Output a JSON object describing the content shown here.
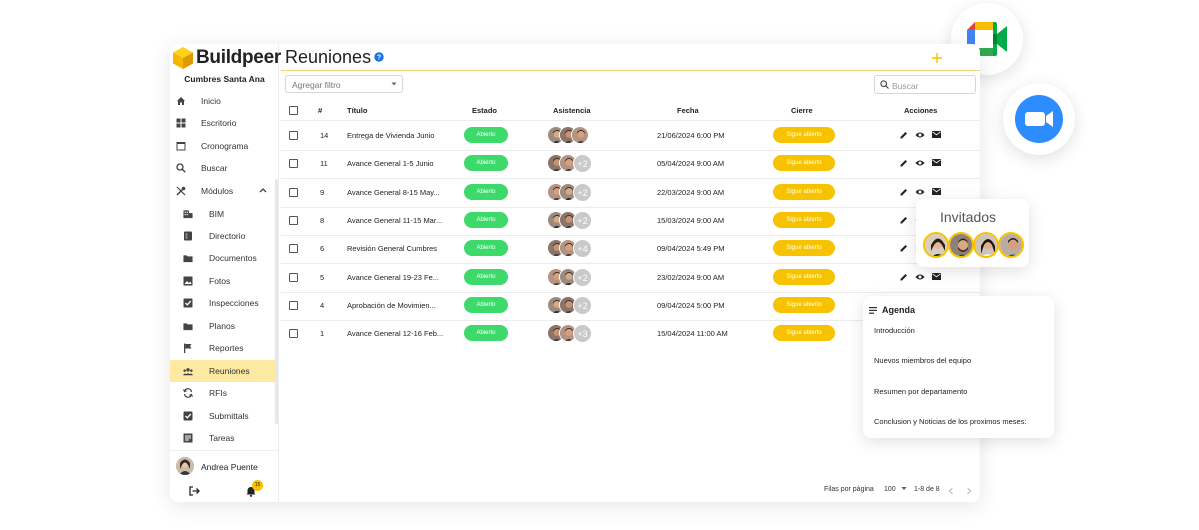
{
  "app": {
    "brand": "Buildpeer",
    "project": "Cumbres Santa Ana",
    "page_title": "Reuniones"
  },
  "sidebar": {
    "items": [
      {
        "label": "Inicio",
        "icon": "home-icon"
      },
      {
        "label": "Escritorio",
        "icon": "grid-icon"
      },
      {
        "label": "Cronograma",
        "icon": "calendar-icon"
      },
      {
        "label": "Buscar",
        "icon": "search-icon"
      },
      {
        "label": "Módulos",
        "icon": "tools-icon"
      }
    ],
    "modules": [
      {
        "label": "BIM",
        "icon": "building-icon"
      },
      {
        "label": "Directorio",
        "icon": "contacts-icon"
      },
      {
        "label": "Documentos",
        "icon": "folder-icon"
      },
      {
        "label": "Fotos",
        "icon": "image-icon"
      },
      {
        "label": "Inspecciones",
        "icon": "checklist-icon"
      },
      {
        "label": "Planos",
        "icon": "blueprint-folder-icon"
      },
      {
        "label": "Reportes",
        "icon": "flag-icon"
      },
      {
        "label": "Reuniones",
        "icon": "group-icon"
      },
      {
        "label": "RFIs",
        "icon": "sync-icon"
      },
      {
        "label": "Submittals",
        "icon": "checkbox-icon"
      },
      {
        "label": "Tareas",
        "icon": "tasks-icon"
      }
    ],
    "active": "Reuniones",
    "user_name": "Andrea Puente",
    "notification_count": "15"
  },
  "toolbar": {
    "filter_placeholder": "Agregar filtro",
    "search_placeholder": "Buscar"
  },
  "table": {
    "columns": [
      "#",
      "Título",
      "Estado",
      "Asistencia",
      "Fecha",
      "Cierre",
      "Acciones"
    ],
    "rows": [
      {
        "num": "14",
        "title": "Entrega de Vivienda Junio",
        "status": "Abierto",
        "attendees": 3,
        "more": "",
        "date": "21/06/2024 6:00 PM",
        "close": "Sigue abierto"
      },
      {
        "num": "11",
        "title": "Avance General 1-5 Junio",
        "status": "Abierto",
        "attendees": 2,
        "more": "+2",
        "date": "05/04/2024 9:00 AM",
        "close": "Sigue abierto"
      },
      {
        "num": "9",
        "title": "Avance General 8-15 May...",
        "status": "Abierto",
        "attendees": 2,
        "more": "+2",
        "date": "22/03/2024 9:00 AM",
        "close": "Sigue abierto"
      },
      {
        "num": "8",
        "title": "Avance General 11-15 Mar...",
        "status": "Abierto",
        "attendees": 2,
        "more": "+2",
        "date": "15/03/2024 9:00 AM",
        "close": "Sigue abierto"
      },
      {
        "num": "6",
        "title": "Revisión General Cumbres",
        "status": "Abierto",
        "attendees": 2,
        "more": "+4",
        "date": "09/04/2024 5:49 PM",
        "close": "Sigue abierto"
      },
      {
        "num": "5",
        "title": "Avance General 19-23 Fe...",
        "status": "Abierto",
        "attendees": 2,
        "more": "+2",
        "date": "23/02/2024 9:00 AM",
        "close": "Sigue abierto"
      },
      {
        "num": "4",
        "title": "Aprobación de Movimien...",
        "status": "Abierto",
        "attendees": 2,
        "more": "+2",
        "date": "09/04/2024 5:00 PM",
        "close": "Sigue abierto"
      },
      {
        "num": "1",
        "title": "Avance General 12-16 Feb...",
        "status": "Abierto",
        "attendees": 2,
        "more": "+3",
        "date": "15/04/2024 11:00 AM",
        "close": "Sigue abierto"
      }
    ]
  },
  "pagination": {
    "rows_label": "Filas por página",
    "rows_value": "100",
    "range": "1-8 de 8"
  },
  "invitados": {
    "title": "Invitados"
  },
  "agenda": {
    "title": "Agenda",
    "items": [
      "Introducción",
      "Nuevos miembros del equipo",
      "Resumen por departamento",
      "Conclusion y Noticias de los proximos meses:"
    ]
  },
  "colors": {
    "accent": "#f7c300",
    "active_bg": "#fde9a2",
    "open_green": "#3dd96b",
    "zoom_blue": "#2d8cff"
  }
}
